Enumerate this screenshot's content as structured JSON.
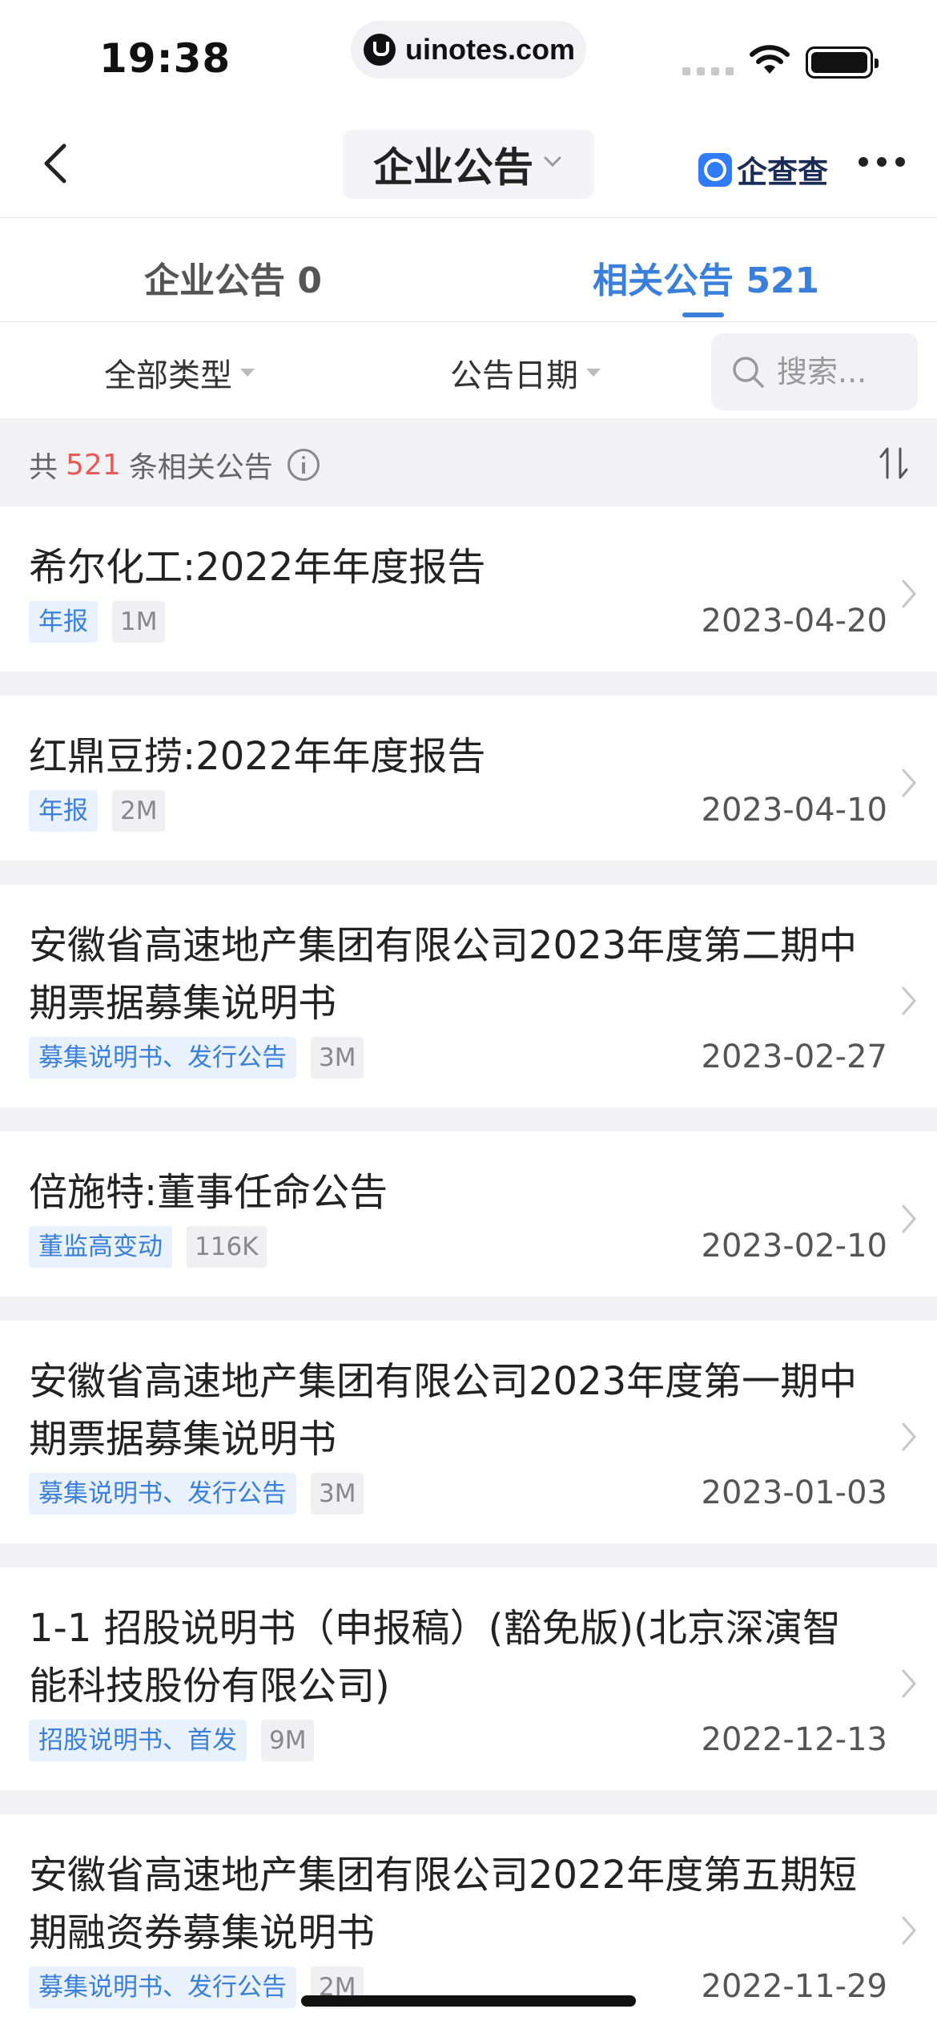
{
  "status_bar": {
    "time": "19:38",
    "site": "uinotes.com"
  },
  "nav": {
    "title": "企业公告",
    "brand": "企查查"
  },
  "tabs": [
    {
      "label": "企业公告 0",
      "active": false
    },
    {
      "label": "相关公告 521",
      "active": true
    }
  ],
  "filters": {
    "type": "全部类型",
    "date": "公告日期",
    "search_placeholder": "搜索..."
  },
  "summary": {
    "prefix": "共",
    "count": "521",
    "suffix": "条相关公告"
  },
  "colors": {
    "accent": "#3a7fdb",
    "count": "#e75a57"
  },
  "items": [
    {
      "title": "希尔化工:2022年年度报告",
      "badge": "年报",
      "size": "1M",
      "date": "2023-04-20"
    },
    {
      "title": "红鼎豆捞:2022年年度报告",
      "badge": "年报",
      "size": "2M",
      "date": "2023-04-10"
    },
    {
      "title": "安徽省高速地产集团有限公司2023年度第二期中期票据募集说明书",
      "badge": "募集说明书、发行公告",
      "size": "3M",
      "date": "2023-02-27"
    },
    {
      "title": "倍施特:董事任命公告",
      "badge": "董监高变动",
      "size": "116K",
      "date": "2023-02-10"
    },
    {
      "title": "安徽省高速地产集团有限公司2023年度第一期中期票据募集说明书",
      "badge": "募集说明书、发行公告",
      "size": "3M",
      "date": "2023-01-03"
    },
    {
      "title": "1-1 招股说明书（申报稿）(豁免版)(北京深演智能科技股份有限公司)",
      "badge": "招股说明书、首发",
      "size": "9M",
      "date": "2022-12-13"
    },
    {
      "title": "安徽省高速地产集团有限公司2022年度第五期短期融资券募集说明书",
      "badge": "募集说明书、发行公告",
      "size": "2M",
      "date": "2022-11-29"
    }
  ]
}
